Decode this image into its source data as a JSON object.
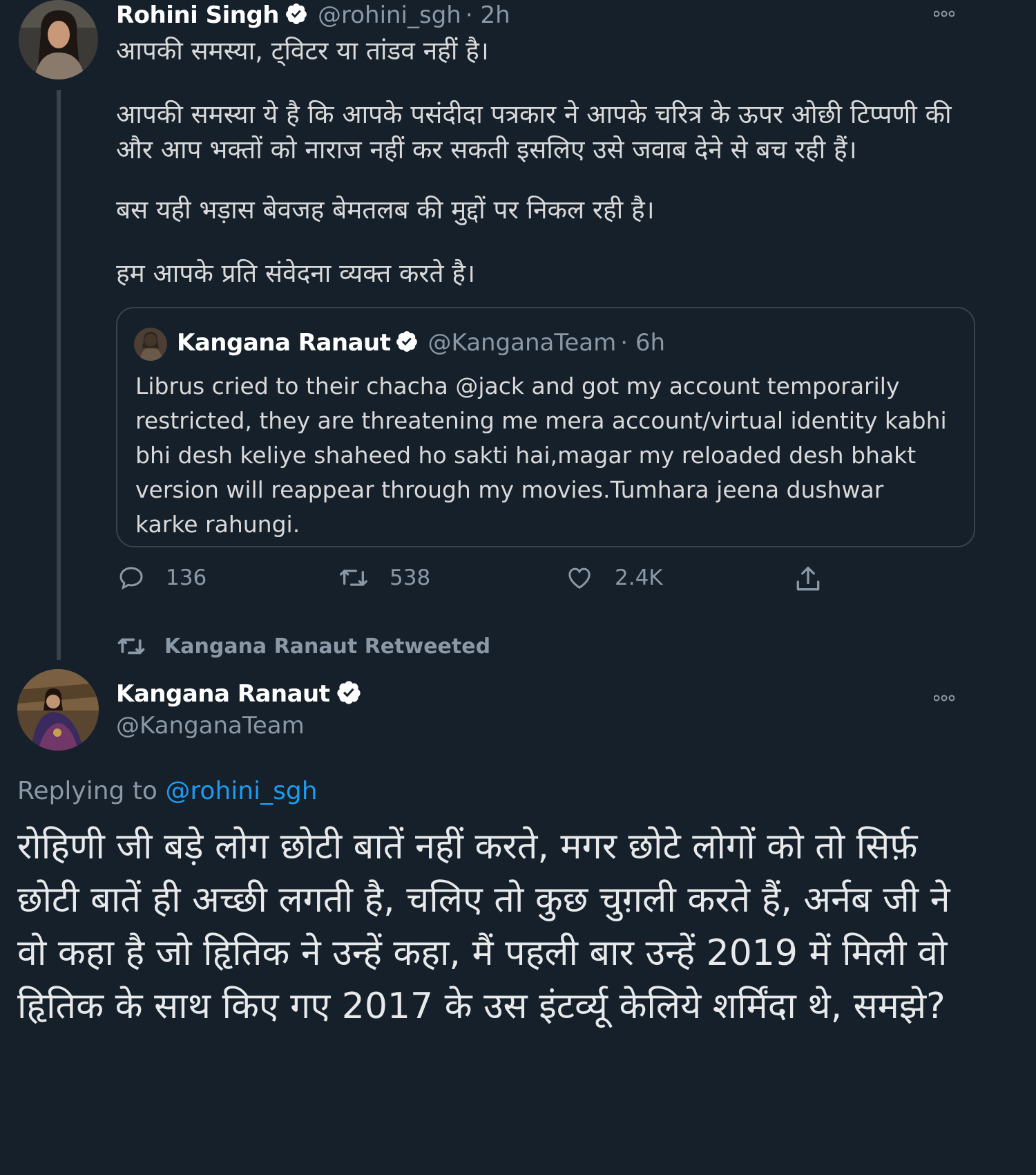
{
  "tweet1": {
    "author_name": "Rohini Singh",
    "author_handle": "@rohini_sgh",
    "time": "· 2h",
    "lines": [
      "आपकी समस्या, ट्विटर या तांडव नहीं है।",
      "आपकी समस्या ये है कि आपके पसंदीदा पत्रकार ने आपके चरित्र के ऊपर ओछी टिप्पणी की और आप भक्तों को नाराज नहीं कर सकती इसलिए उसे जवाब देने से बच रही हैं।",
      "बस यही भड़ास बेवजह बेमतलब की मुद्दों पर निकल रही है।",
      "हम आपके प्रति संवेदना व्यक्त करते है।"
    ],
    "quote": {
      "author_name": "Kangana Ranaut",
      "author_handle": "@KanganaTeam",
      "time": "· 6h",
      "text": "Librus cried to their chacha @jack and got my account temporarily restricted, they are threatening me mera account/virtual identity kabhi bhi desh keliye shaheed ho sakti hai,magar my reloaded desh bhakt version will reappear through my movies.Tumhara jeena dushwar karke rahungi."
    },
    "actions": {
      "replies": "136",
      "retweets": "538",
      "likes": "2.4K"
    }
  },
  "retweet_label": "Kangana Ranaut Retweeted",
  "tweet2": {
    "author_name": "Kangana Ranaut",
    "author_handle": "@KanganaTeam",
    "replying_prefix": "Replying to",
    "replying_handle": "@rohini_sgh",
    "text": "रोहिणी जी बड़े लोग छोटी बातें नहीं करते, मगर छोटे लोगों को तो सिर्फ़ छोटी बातें ही अच्छी लगती है, चलिए तो कुछ चुग़ली करते हैं, अर्नब जी ने वो कहा है जो हिृतिक ने उन्हें कहा, मैं पहली बार उन्हें 2019 में मिली वो हिृतिक के साथ किए गए 2017 के उस इंटर्व्यू केलिये शर्मिंदा थे, समझे?"
  },
  "icons": {
    "more": "more-dots-icon",
    "verified": "verified-badge-icon",
    "reply": "reply-icon",
    "retweet": "retweet-icon",
    "like": "heart-icon",
    "share": "share-icon"
  },
  "colors": {
    "background": "#15202b",
    "accent": "#1d9bf0",
    "muted": "#8b98a5"
  }
}
